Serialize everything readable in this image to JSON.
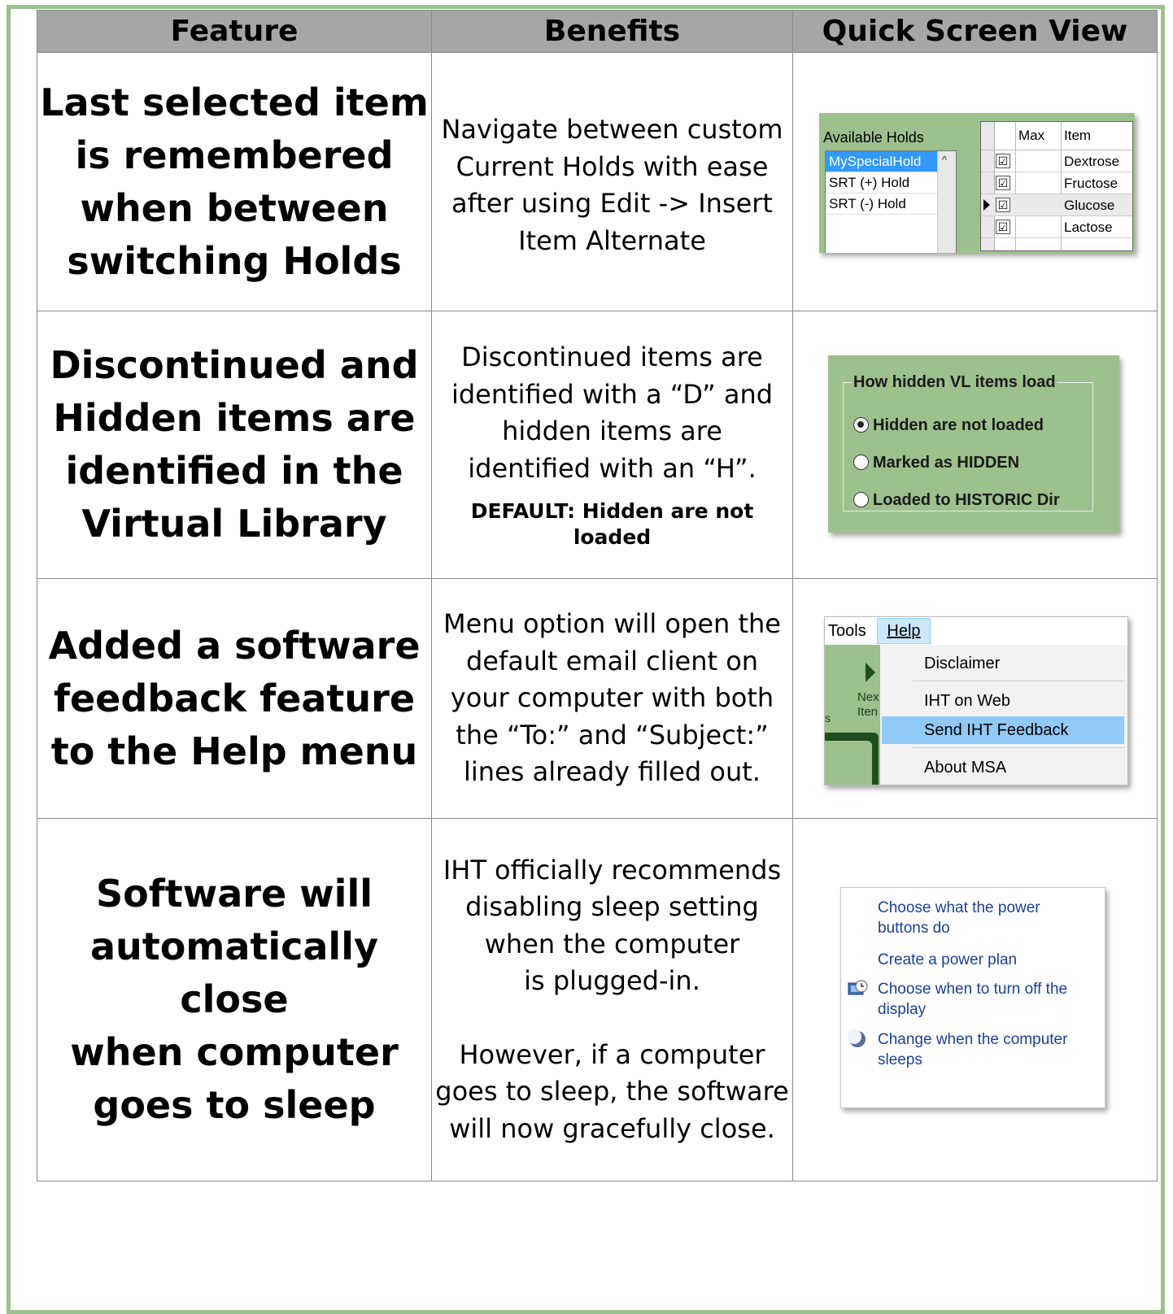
{
  "headers": {
    "feature": "Feature",
    "benefits": "Benefits",
    "quick_view": "Quick Screen View"
  },
  "rows": [
    {
      "feature": [
        "Last selected item",
        "is remembered",
        "when between",
        "switching Holds"
      ],
      "benefit": [
        "Navigate between custom",
        "Current Holds with ease",
        "after using Edit -> Insert",
        "Item Alternate"
      ]
    },
    {
      "feature": [
        "Discontinued and",
        "Hidden items are",
        "identified in the",
        "Virtual Library"
      ],
      "benefit": [
        "Discontinued items are",
        "identified with a “D” and",
        "hidden items are",
        "identified with an “H”."
      ],
      "default_note": "DEFAULT: Hidden are not loaded"
    },
    {
      "feature": [
        "Added a software",
        "feedback feature",
        "to the Help menu"
      ],
      "benefit": [
        "Menu option will open the",
        "default email client on",
        "your computer with both",
        "the “To:” and “Subject:”",
        "lines already filled out."
      ]
    },
    {
      "feature": [
        "Software will",
        "automatically close",
        "when computer",
        "goes to sleep"
      ],
      "benefit": [
        "IHT officially recommends",
        "disabling sleep setting",
        "when the computer",
        "is plugged-in.",
        "",
        "However, if a computer",
        "goes to sleep, the software",
        "will now gracefully close."
      ]
    }
  ],
  "shot_holds": {
    "available_label": "Available Holds",
    "holds": [
      "MySpecialHold",
      "SRT (+) Hold",
      "SRT (-) Hold"
    ],
    "selected_hold": "MySpecialHold",
    "col_max": "Max",
    "col_item": "Item",
    "items": [
      "Dextrose",
      "Fructose",
      "Glucose",
      "Lactose"
    ],
    "check_glyph": "☑",
    "scroll_up_glyph": "^"
  },
  "shot_hidden": {
    "legend": "How hidden VL items load",
    "options": [
      "Hidden are not loaded",
      "Marked as HIDDEN",
      "Loaded to HISTORIC Dir"
    ],
    "selected_option": "Hidden are not loaded"
  },
  "shot_menu": {
    "menu_tools": "Tools",
    "menu_help": "Help",
    "items": [
      "Disclaimer",
      "IHT on Web",
      "Send IHT Feedback",
      "About MSA"
    ],
    "highlighted_item": "Send IHT Feedback",
    "cut_labels": [
      "Nex",
      "Iten",
      "s"
    ]
  },
  "shot_power": {
    "links": [
      "Choose what the power buttons do",
      "Create a power plan",
      "Choose when to turn off the display",
      "Change when the computer sleeps"
    ],
    "icons": [
      "display-clock-icon",
      "moon-sleep-icon"
    ]
  },
  "colors": {
    "border_green": "#9cc18d",
    "header_gray": "#a6a6a6",
    "link_blue": "#1a3f9a",
    "selection_blue": "#3399ff"
  }
}
